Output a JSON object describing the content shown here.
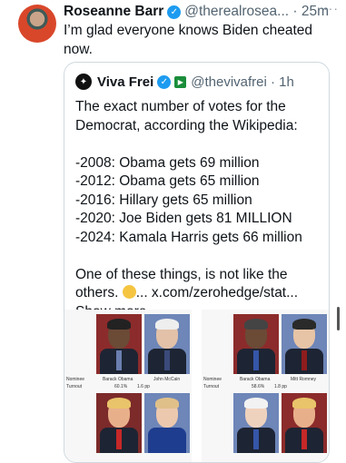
{
  "tweet": {
    "author_name": "Roseanne Barr",
    "handle_time": "@therealrosea... · 25m",
    "text": "I’m glad everyone knows Biden cheated now."
  },
  "quote": {
    "author_name": "Viva Frei",
    "handle_time": "@thevivafrei · 1h",
    "intro": "The exact number of votes for the Democrat, according the Wikipedia:",
    "lines": [
      "-2008: Obama gets 69 million",
      "-2012: Obama gets 65 million",
      "-2016: Hillary gets 65 million",
      "-2020: Joe Biden gets 81 MILLION",
      "-2024: Kamala Harris gets 66 million"
    ],
    "outro_before_emoji": "One of these things, is not like the others.",
    "outro_after_emoji": "... x.com/zerohedge/stat...",
    "show_more": "Show more"
  },
  "media": {
    "left": {
      "nominee_label": "Nominee",
      "turnout_label": "Turnout",
      "candidate_1": "Barack Obama",
      "candidate_2": "John McCain",
      "turnout_value": "60.1%",
      "turnout_change": "1.6 pp"
    },
    "right": {
      "nominee_label": "Nominee",
      "turnout_label": "Turnout",
      "candidate_1": "Barack Obama",
      "candidate_2": "Mitt Romney",
      "turnout_value": "58.6%",
      "turnout_change": "1.8 pp"
    }
  },
  "colors": {
    "verified": "#1d9bf0",
    "muted": "#536471",
    "border": "#cfd9de"
  },
  "icons": [
    "verified-badge-icon",
    "more-options-icon",
    "channel-square-icon",
    "thinking-face-emoji-icon"
  ]
}
